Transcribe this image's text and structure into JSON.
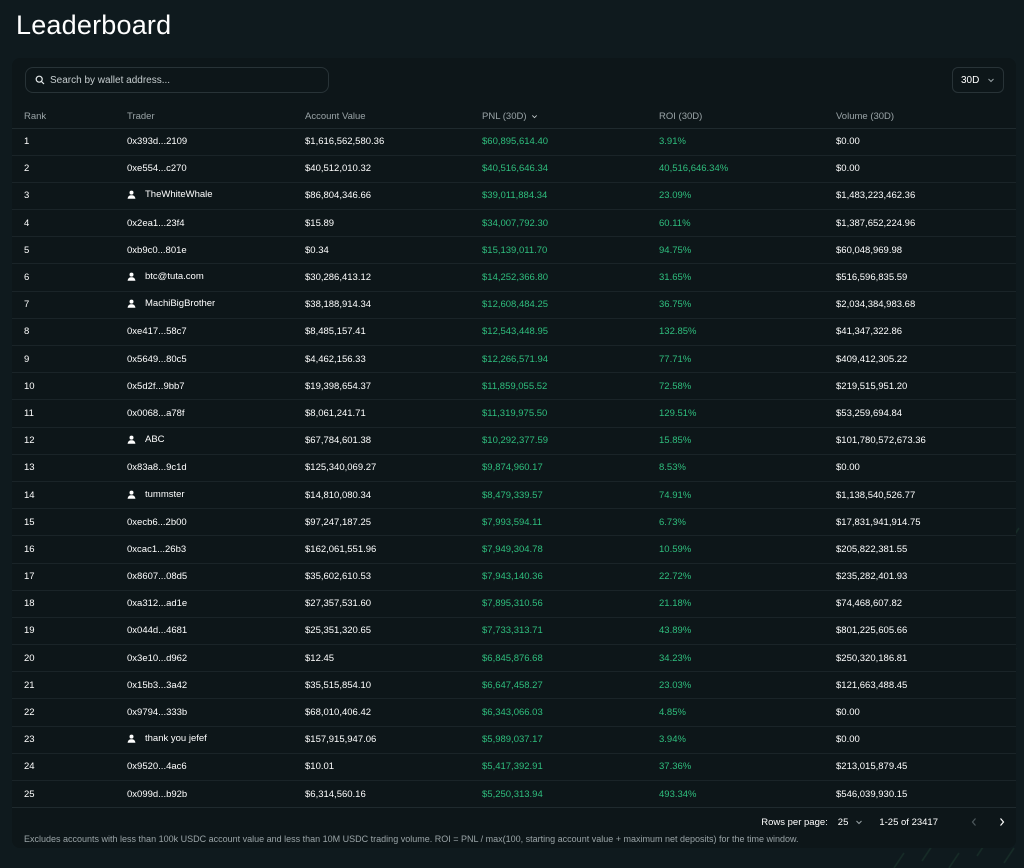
{
  "page": {
    "title": "Leaderboard"
  },
  "search": {
    "placeholder": "Search by wallet address..."
  },
  "period": {
    "selected": "30D"
  },
  "table": {
    "columns": {
      "rank": "Rank",
      "trader": "Trader",
      "account_value": "Account Value",
      "pnl": "PNL (30D)",
      "roi": "ROI (30D)",
      "volume": "Volume (30D)"
    },
    "sorted_column": "pnl",
    "rows": [
      {
        "rank": "1",
        "trader": "0x393d...2109",
        "user": false,
        "account_value": "$1,616,562,580.36",
        "pnl": "$60,895,614.40",
        "roi": "3.91%",
        "volume": "$0.00"
      },
      {
        "rank": "2",
        "trader": "0xe554...c270",
        "user": false,
        "account_value": "$40,512,010.32",
        "pnl": "$40,516,646.34",
        "roi": "40,516,646.34%",
        "volume": "$0.00"
      },
      {
        "rank": "3",
        "trader": "TheWhiteWhale",
        "user": true,
        "account_value": "$86,804,346.66",
        "pnl": "$39,011,884.34",
        "roi": "23.09%",
        "volume": "$1,483,223,462.36"
      },
      {
        "rank": "4",
        "trader": "0x2ea1...23f4",
        "user": false,
        "account_value": "$15.89",
        "pnl": "$34,007,792.30",
        "roi": "60.11%",
        "volume": "$1,387,652,224.96"
      },
      {
        "rank": "5",
        "trader": "0xb9c0...801e",
        "user": false,
        "account_value": "$0.34",
        "pnl": "$15,139,011.70",
        "roi": "94.75%",
        "volume": "$60,048,969.98"
      },
      {
        "rank": "6",
        "trader": "btc@tuta.com",
        "user": true,
        "account_value": "$30,286,413.12",
        "pnl": "$14,252,366.80",
        "roi": "31.65%",
        "volume": "$516,596,835.59"
      },
      {
        "rank": "7",
        "trader": "MachiBigBrother",
        "user": true,
        "account_value": "$38,188,914.34",
        "pnl": "$12,608,484.25",
        "roi": "36.75%",
        "volume": "$2,034,384,983.68"
      },
      {
        "rank": "8",
        "trader": "0xe417...58c7",
        "user": false,
        "account_value": "$8,485,157.41",
        "pnl": "$12,543,448.95",
        "roi": "132.85%",
        "volume": "$41,347,322.86"
      },
      {
        "rank": "9",
        "trader": "0x5649...80c5",
        "user": false,
        "account_value": "$4,462,156.33",
        "pnl": "$12,266,571.94",
        "roi": "77.71%",
        "volume": "$409,412,305.22"
      },
      {
        "rank": "10",
        "trader": "0x5d2f...9bb7",
        "user": false,
        "account_value": "$19,398,654.37",
        "pnl": "$11,859,055.52",
        "roi": "72.58%",
        "volume": "$219,515,951.20"
      },
      {
        "rank": "11",
        "trader": "0x0068...a78f",
        "user": false,
        "account_value": "$8,061,241.71",
        "pnl": "$11,319,975.50",
        "roi": "129.51%",
        "volume": "$53,259,694.84"
      },
      {
        "rank": "12",
        "trader": "ABC",
        "user": true,
        "account_value": "$67,784,601.38",
        "pnl": "$10,292,377.59",
        "roi": "15.85%",
        "volume": "$101,780,572,673.36"
      },
      {
        "rank": "13",
        "trader": "0x83a8...9c1d",
        "user": false,
        "account_value": "$125,340,069.27",
        "pnl": "$9,874,960.17",
        "roi": "8.53%",
        "volume": "$0.00"
      },
      {
        "rank": "14",
        "trader": "tummster",
        "user": true,
        "account_value": "$14,810,080.34",
        "pnl": "$8,479,339.57",
        "roi": "74.91%",
        "volume": "$1,138,540,526.77"
      },
      {
        "rank": "15",
        "trader": "0xecb6...2b00",
        "user": false,
        "account_value": "$97,247,187.25",
        "pnl": "$7,993,594.11",
        "roi": "6.73%",
        "volume": "$17,831,941,914.75"
      },
      {
        "rank": "16",
        "trader": "0xcac1...26b3",
        "user": false,
        "account_value": "$162,061,551.96",
        "pnl": "$7,949,304.78",
        "roi": "10.59%",
        "volume": "$205,822,381.55"
      },
      {
        "rank": "17",
        "trader": "0x8607...08d5",
        "user": false,
        "account_value": "$35,602,610.53",
        "pnl": "$7,943,140.36",
        "roi": "22.72%",
        "volume": "$235,282,401.93"
      },
      {
        "rank": "18",
        "trader": "0xa312...ad1e",
        "user": false,
        "account_value": "$27,357,531.60",
        "pnl": "$7,895,310.56",
        "roi": "21.18%",
        "volume": "$74,468,607.82"
      },
      {
        "rank": "19",
        "trader": "0x044d...4681",
        "user": false,
        "account_value": "$25,351,320.65",
        "pnl": "$7,733,313.71",
        "roi": "43.89%",
        "volume": "$801,225,605.66"
      },
      {
        "rank": "20",
        "trader": "0x3e10...d962",
        "user": false,
        "account_value": "$12.45",
        "pnl": "$6,845,876.68",
        "roi": "34.23%",
        "volume": "$250,320,186.81"
      },
      {
        "rank": "21",
        "trader": "0x15b3...3a42",
        "user": false,
        "account_value": "$35,515,854.10",
        "pnl": "$6,647,458.27",
        "roi": "23.03%",
        "volume": "$121,663,488.45"
      },
      {
        "rank": "22",
        "trader": "0x9794...333b",
        "user": false,
        "account_value": "$68,010,406.42",
        "pnl": "$6,343,066.03",
        "roi": "4.85%",
        "volume": "$0.00"
      },
      {
        "rank": "23",
        "trader": "thank you jefef",
        "user": true,
        "account_value": "$157,915,947.06",
        "pnl": "$5,989,037.17",
        "roi": "3.94%",
        "volume": "$0.00"
      },
      {
        "rank": "24",
        "trader": "0x9520...4ac6",
        "user": false,
        "account_value": "$10.01",
        "pnl": "$5,417,392.91",
        "roi": "37.36%",
        "volume": "$213,015,879.45"
      },
      {
        "rank": "25",
        "trader": "0x099d...b92b",
        "user": false,
        "account_value": "$6,314,560.16",
        "pnl": "$5,250,313.94",
        "roi": "493.34%",
        "volume": "$546,039,930.15"
      }
    ]
  },
  "pagination": {
    "rows_per_page_label": "Rows per page:",
    "rows_per_page": "25",
    "range": "1-25 of 23417"
  },
  "footnote": "Excludes accounts with less than 100k USDC account value and less than 10M USDC trading volume. ROI = PNL / max(100, starting account value + maximum net deposits) for the time window.",
  "colors": {
    "background": "#0f1a1e",
    "panel": "#0d1619",
    "positive": "#2fbf7e",
    "muted_text": "#9aa4a7",
    "border": "#283337"
  },
  "icons": {
    "search": "search-icon",
    "user": "user-icon",
    "chevron_down": "chevron-down-icon",
    "prev": "chevron-left-icon",
    "next": "chevron-right-icon"
  }
}
